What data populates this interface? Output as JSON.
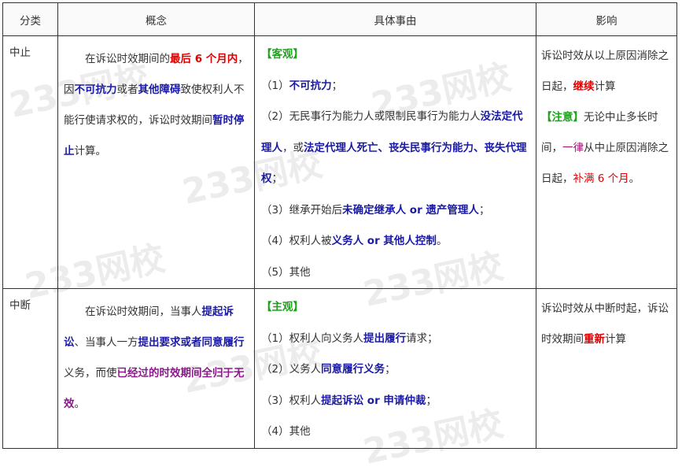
{
  "headers": [
    "分类",
    "概念",
    "具体事由",
    "影响"
  ],
  "watermark": "233网校",
  "rows": [
    {
      "category": "中止",
      "concept": [
        {
          "t": "在诉讼时效期间的",
          "s": "n"
        },
        {
          "t": "最后 6 个月内",
          "s": "r"
        },
        {
          "t": "，因",
          "s": "n"
        },
        {
          "t": "不可抗力",
          "s": "b"
        },
        {
          "t": "或者",
          "s": "n"
        },
        {
          "t": "其他障碍",
          "s": "b"
        },
        {
          "t": "致使权利人不能行使请求权的，诉讼时效期间",
          "s": "n"
        },
        {
          "t": "暂时停止",
          "s": "b"
        },
        {
          "t": "计算。",
          "s": "n"
        }
      ],
      "reason_tag": "【客观】",
      "reasons": [
        [
          {
            "t": "（1）",
            "s": "n"
          },
          {
            "t": "不可抗力",
            "s": "b"
          },
          {
            "t": "；",
            "s": "n"
          }
        ],
        [
          {
            "t": "（2）无民事行为能力人或限制民事行为能力人",
            "s": "n"
          },
          {
            "t": "没法定代理人",
            "s": "b"
          },
          {
            "t": "，或",
            "s": "n"
          },
          {
            "t": "法定代理人死亡、丧失民事行为能力、丧失代理权",
            "s": "b"
          },
          {
            "t": "；",
            "s": "n"
          }
        ],
        [
          {
            "t": "（3）继承开始后",
            "s": "n"
          },
          {
            "t": "未确定继承人 or 遗产管理人",
            "s": "b"
          },
          {
            "t": "；",
            "s": "n"
          }
        ],
        [
          {
            "t": "（4）权利人被",
            "s": "n"
          },
          {
            "t": "义务人 or 其他人控制",
            "s": "b"
          },
          {
            "t": "。",
            "s": "n"
          }
        ],
        [
          {
            "t": "（5）其他",
            "s": "n"
          }
        ]
      ],
      "impact": [
        {
          "t": "诉讼时效从以上原因消除之日起，",
          "s": "n"
        },
        {
          "t": "继续",
          "s": "r"
        },
        {
          "t": "计算",
          "s": "n"
        }
      ],
      "impact2": [
        {
          "t": "【注意】",
          "s": "g"
        },
        {
          "t": "无论中止多长时间，",
          "s": "n"
        },
        {
          "t": "一律",
          "s": "pn"
        },
        {
          "t": "从中止原因消除之日起，",
          "s": "n"
        },
        {
          "t": "补满 6 个月",
          "s": "rn"
        },
        {
          "t": "。",
          "s": "n"
        }
      ]
    },
    {
      "category": "中断",
      "concept": [
        {
          "t": "在诉讼时效期间，当事人",
          "s": "n"
        },
        {
          "t": "提起诉讼",
          "s": "b"
        },
        {
          "t": "、当事人一方",
          "s": "n"
        },
        {
          "t": "提出要求或者同意履行",
          "s": "b"
        },
        {
          "t": "义务，而使",
          "s": "n"
        },
        {
          "t": "已经过的时效期间全归于无效",
          "s": "p"
        },
        {
          "t": "。",
          "s": "n"
        }
      ],
      "reason_tag": "【主观】",
      "reasons": [
        [
          {
            "t": "（1）权利人向义务人",
            "s": "n"
          },
          {
            "t": "提出履行",
            "s": "b"
          },
          {
            "t": "请求；",
            "s": "n"
          }
        ],
        [
          {
            "t": "（2）义务人",
            "s": "n"
          },
          {
            "t": "同意履行义务",
            "s": "b"
          },
          {
            "t": "；",
            "s": "n"
          }
        ],
        [
          {
            "t": "（3）权利人",
            "s": "n"
          },
          {
            "t": "提起诉讼 or 申请仲裁",
            "s": "b"
          },
          {
            "t": "；",
            "s": "n"
          }
        ],
        [
          {
            "t": "（4）其他",
            "s": "n"
          }
        ]
      ],
      "impact": [
        {
          "t": "诉讼时效从中断时起，诉讼时效期间",
          "s": "n"
        },
        {
          "t": "重新",
          "s": "r"
        },
        {
          "t": "计算",
          "s": "n"
        }
      ],
      "impact2": []
    }
  ]
}
